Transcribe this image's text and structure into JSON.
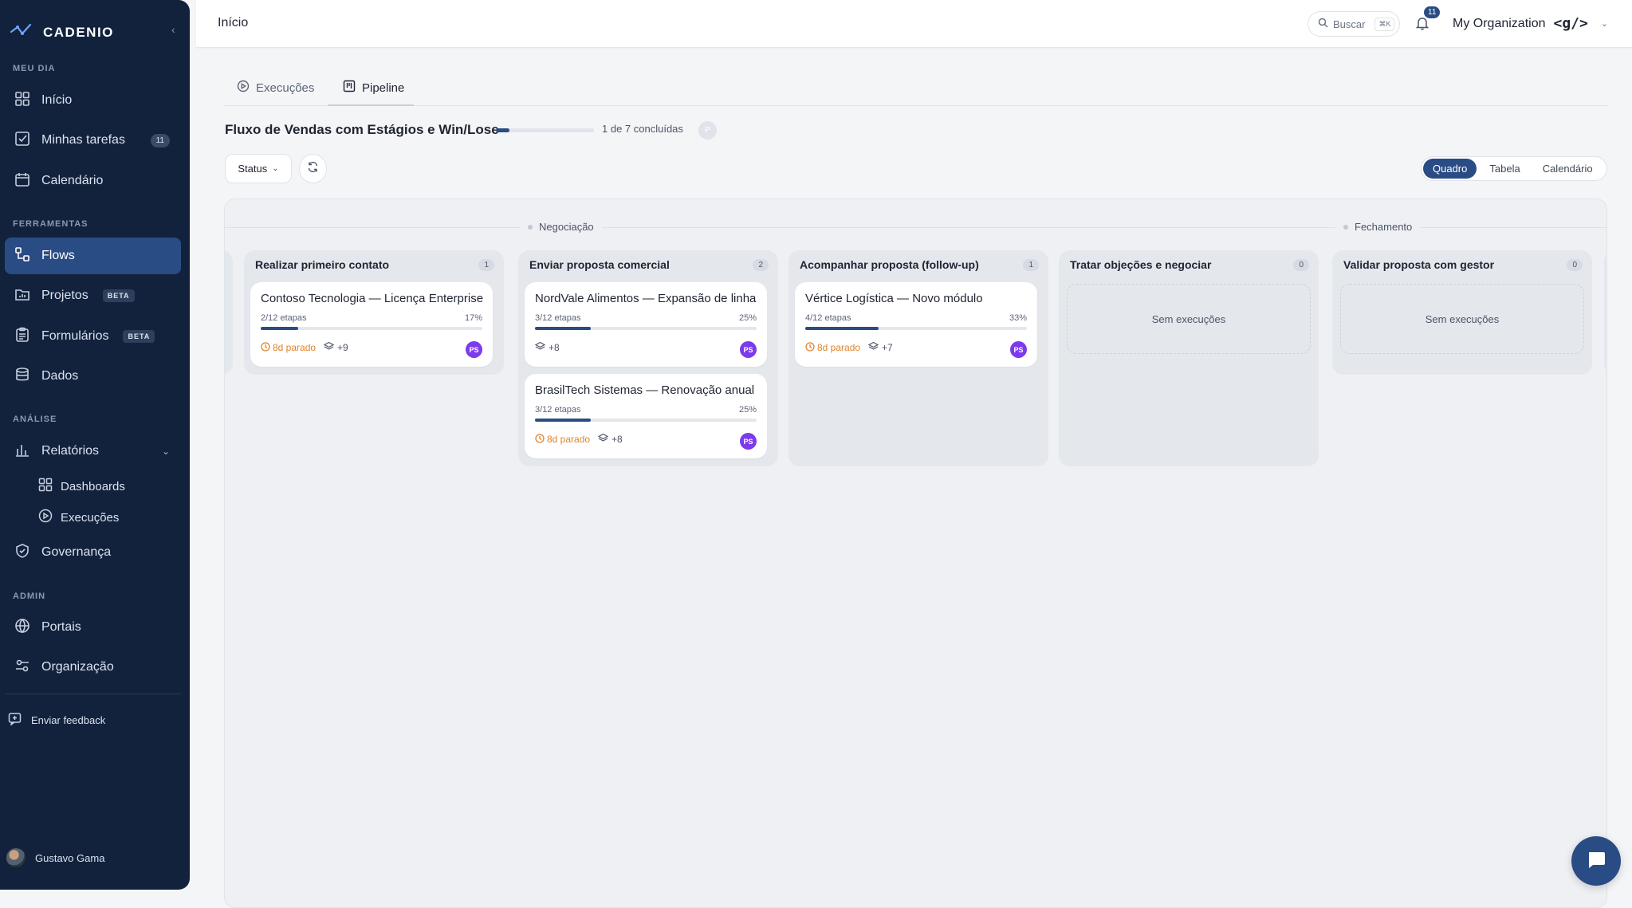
{
  "sidebar": {
    "brand": "CADENIO",
    "sections": {
      "meu_dia": "MEU DIA",
      "ferramentas": "FERRAMENTAS",
      "analise": "ANÁLISE",
      "admin": "ADMIN"
    },
    "items": {
      "inicio": "Início",
      "minhas_tarefas": "Minhas tarefas",
      "minhas_tarefas_count": "11",
      "calendario": "Calendário",
      "flows": "Flows",
      "projetos": "Projetos",
      "formularios": "Formulários",
      "beta": "BETA",
      "dados": "Dados",
      "relatorios": "Relatórios",
      "dashboards": "Dashboards",
      "execucoes": "Execuções",
      "governanca": "Governança",
      "portais": "Portais",
      "organizacao": "Organização"
    },
    "feedback": "Enviar feedback",
    "user_name": "Gustavo Gama"
  },
  "topbar": {
    "title": "Início",
    "search_label": "Buscar",
    "search_shortcut": "⌘K",
    "notifications_count": "11",
    "org_name": "My Organization",
    "org_logo": "<g/>"
  },
  "tabs": {
    "execucoes": "Execuções",
    "pipeline": "Pipeline"
  },
  "flow": {
    "title": "Fluxo de Vendas com Estágios e Win/Lose",
    "progress_fraction": 0.14,
    "progress_text": "1 de 7 concluídas",
    "avatar_initial": "P"
  },
  "controls": {
    "status_label": "Status",
    "views": [
      "Quadro",
      "Tabela",
      "Calendário"
    ],
    "active_view": "Quadro"
  },
  "board": {
    "stages": {
      "negociacao": "Negociação",
      "fechamento": "Fechamento"
    },
    "columns": [
      {
        "title": "Realizar primeiro contato",
        "count": "1",
        "cards": [
          {
            "title": "Contoso Tecnologia — Licença Enterprise",
            "steps": "2/12 etapas",
            "pct": "17%",
            "progress": 0.17,
            "stale": "8d parado",
            "more": "+9",
            "assignee": "PS"
          }
        ]
      },
      {
        "title": "Enviar proposta comercial",
        "count": "2",
        "cards": [
          {
            "title": "NordVale Alimentos — Expansão de linha",
            "steps": "3/12 etapas",
            "pct": "25%",
            "progress": 0.25,
            "stale": "",
            "more": "+8",
            "assignee": "PS"
          },
          {
            "title": "BrasilTech Sistemas — Renovação anual",
            "steps": "3/12 etapas",
            "pct": "25%",
            "progress": 0.25,
            "stale": "8d parado",
            "more": "+8",
            "assignee": "PS"
          }
        ]
      },
      {
        "title": "Acompanhar proposta (follow-up)",
        "count": "1",
        "cards": [
          {
            "title": "Vértice Logística — Novo módulo",
            "steps": "4/12 etapas",
            "pct": "33%",
            "progress": 0.33,
            "stale": "8d parado",
            "more": "+7",
            "assignee": "PS"
          }
        ]
      },
      {
        "title": "Tratar objeções e negociar",
        "count": "0",
        "empty": "Sem execuções"
      },
      {
        "title": "Validar proposta com gestor",
        "count": "0",
        "empty": "Sem execuções"
      }
    ]
  },
  "colors": {
    "sidebar_bg": "#12223d",
    "accent": "#2a4c84",
    "stale": "#e0832a",
    "assignee": "#7c3aed"
  }
}
